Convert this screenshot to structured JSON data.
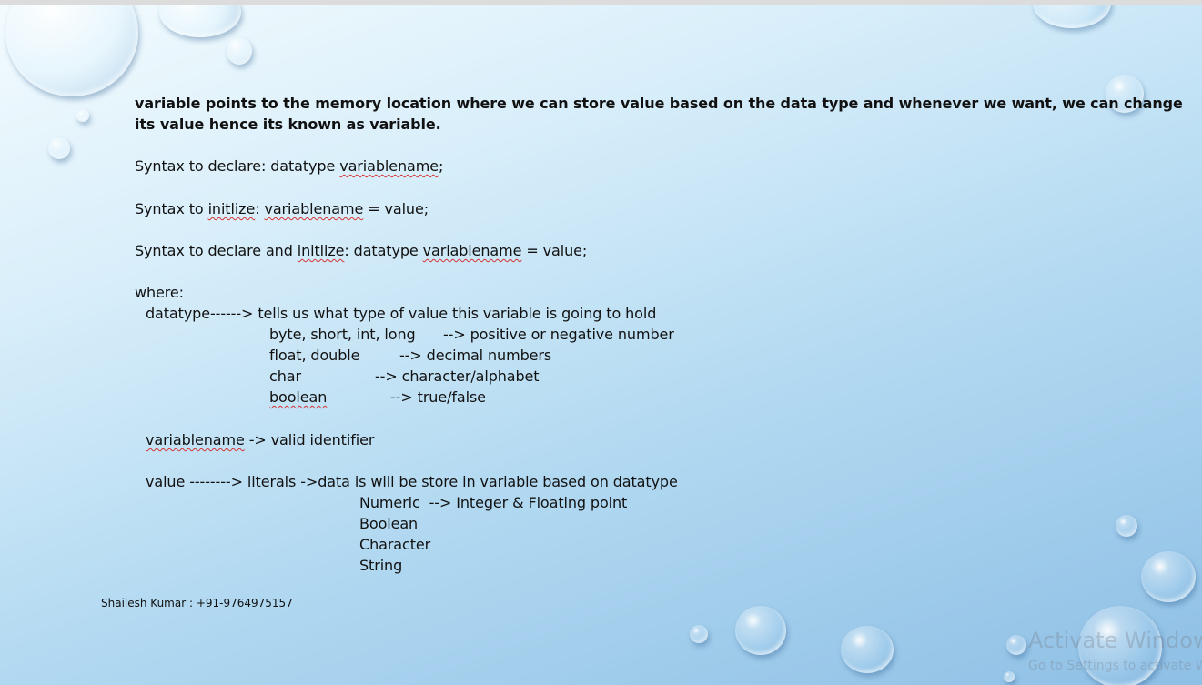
{
  "slide": {
    "intro": {
      "line1": "variable points to the memory location where we can store value based on the data type and whenever we want, we can change",
      "line2": "its value hence its known as variable."
    },
    "syntax_declare": {
      "prefix": "Syntax to declare: datatype ",
      "var": "variablename",
      "suffix": ";"
    },
    "syntax_init": {
      "prefix": "Syntax to ",
      "word": "initlize",
      "mid": ": ",
      "var": "variablename",
      "suffix": " = value;"
    },
    "syntax_both": {
      "prefix": "Syntax to declare and ",
      "word": "initlize",
      "mid": ": datatype ",
      "var": "variablename",
      "suffix": " = value;"
    },
    "where": "where:",
    "datatype": {
      "head": "datatype------> tells us what type of value this variable is going to hold",
      "rows": [
        {
          "types": "byte, short, int, long",
          "arrow": " --> positive or negative number"
        },
        {
          "types": "float, double",
          "arrow": "--> decimal numbers"
        },
        {
          "types": "char",
          "arrow": "--> character/alphabet"
        },
        {
          "types": "boolean",
          "arrow": "--> true/false"
        }
      ]
    },
    "variablename_line": {
      "var": "variablename",
      "suffix": " -> valid identifier"
    },
    "value": {
      "head": "value --------> literals ->data is will be store in variable based on datatype",
      "items": [
        "Numeric  --> Integer & Floating point",
        "Boolean",
        "Character",
        "String"
      ]
    },
    "footer": "Shailesh Kumar : +91-9764975157"
  },
  "watermark": {
    "line1": "Activate Windows",
    "line2": "Go to Settings to activate Windows."
  }
}
